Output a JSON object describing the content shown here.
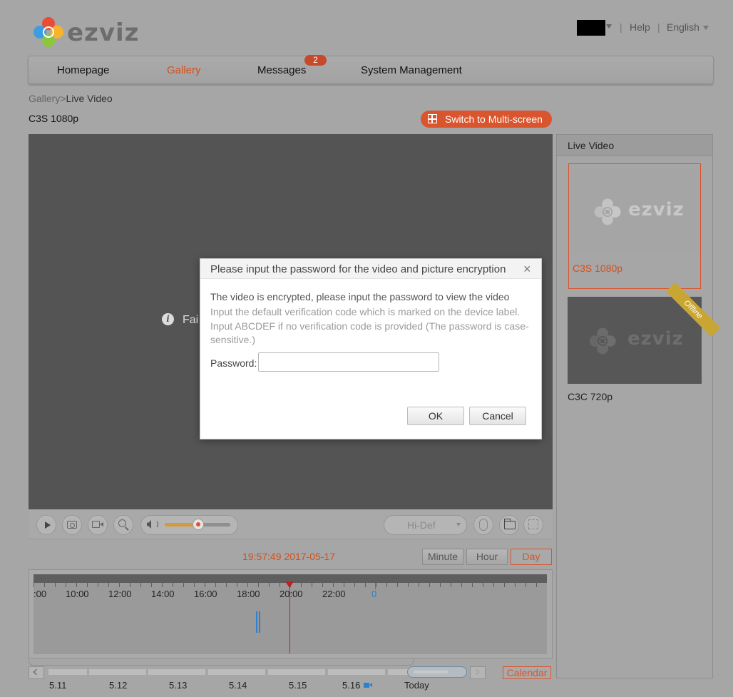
{
  "brand": {
    "logo_text": "ezviz"
  },
  "header": {
    "help": "Help",
    "separator": "|",
    "language": "English"
  },
  "nav": {
    "items": [
      {
        "label": "Homepage"
      },
      {
        "label": "Gallery",
        "active": true
      },
      {
        "label": "Messages",
        "badge": "2"
      },
      {
        "label": "System Management"
      }
    ]
  },
  "breadcrumb": {
    "parent": "Gallery",
    "separator": ">",
    "current": "Live Video"
  },
  "device_title": "C3S 1080p",
  "switch_multiscreen": "Switch to Multi-screen",
  "video": {
    "info_icon": "i",
    "status_text": "Fai"
  },
  "controls": {
    "quality": "Hi-Def",
    "volume_percent": 50
  },
  "time": {
    "timestamp": "19:57:49 2017-05-17",
    "buttons": [
      "Minute",
      "Hour",
      "Day"
    ],
    "active": "Day"
  },
  "timeline": {
    "labels": [
      ":00",
      "10:00",
      "12:00",
      "14:00",
      "16:00",
      "18:00",
      "20:00",
      "22:00",
      "0"
    ]
  },
  "dates": {
    "labels": [
      "5.11",
      "5.12",
      "5.13",
      "5.14",
      "5.15",
      "5.16",
      "Today"
    ],
    "calendar": "Calendar"
  },
  "panel": {
    "title": "Live Video",
    "cameras": [
      {
        "name": "C3S 1080p",
        "logo": "ezviz",
        "selected": true
      },
      {
        "name": "C3C 720p",
        "logo": "ezviz",
        "status": "Offline"
      }
    ]
  },
  "modal": {
    "title": "Please input the password for the video and picture encryption",
    "close": "×",
    "line1": "The video is encrypted, please input the password to view the video",
    "line2": "Input the default verification code which is marked on the device label. Input ABCDEF if no verification code is provided (The password is case-sensitive.)",
    "password_label": "Password:",
    "password_value": "",
    "ok": "OK",
    "cancel": "Cancel"
  },
  "colors": {
    "accent": "#d9552e",
    "timeline_blue": "#2f7fcf",
    "cursor_red": "#c02020"
  }
}
